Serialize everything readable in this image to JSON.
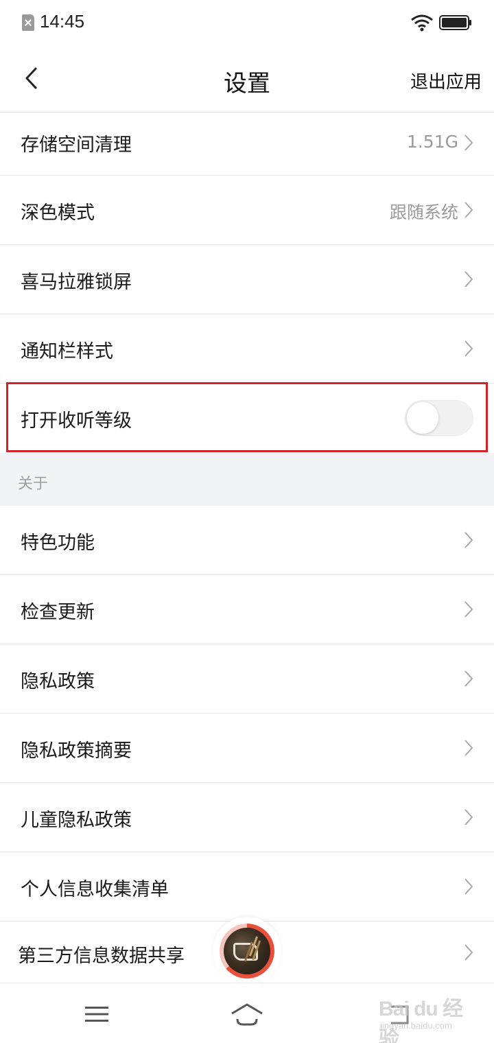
{
  "status_bar": {
    "time": "14:45"
  },
  "header": {
    "title": "设置",
    "exit_label": "退出应用"
  },
  "settings": [
    {
      "label": "存储空间清理",
      "value": "1.51G"
    },
    {
      "label": "深色模式",
      "value": "跟随系统"
    },
    {
      "label": "喜马拉雅锁屏",
      "value": ""
    },
    {
      "label": "通知栏样式",
      "value": ""
    },
    {
      "label": "打开收听等级",
      "toggle_on": false
    }
  ],
  "about_section": {
    "title": "关于",
    "items": [
      {
        "label": "特色功能"
      },
      {
        "label": "检查更新"
      },
      {
        "label": "隐私政策"
      },
      {
        "label": "隐私政策摘要"
      },
      {
        "label": "儿童隐私政策"
      },
      {
        "label": "个人信息收集清单"
      },
      {
        "label": "第三方信息数据共享"
      }
    ]
  },
  "watermark": {
    "main": "Bai du 经验",
    "sub": "jingyan.baidu.com"
  },
  "colors": {
    "highlight": "#d42027",
    "player_progress": "#e8503a",
    "section_bg": "#f2f3f5"
  }
}
